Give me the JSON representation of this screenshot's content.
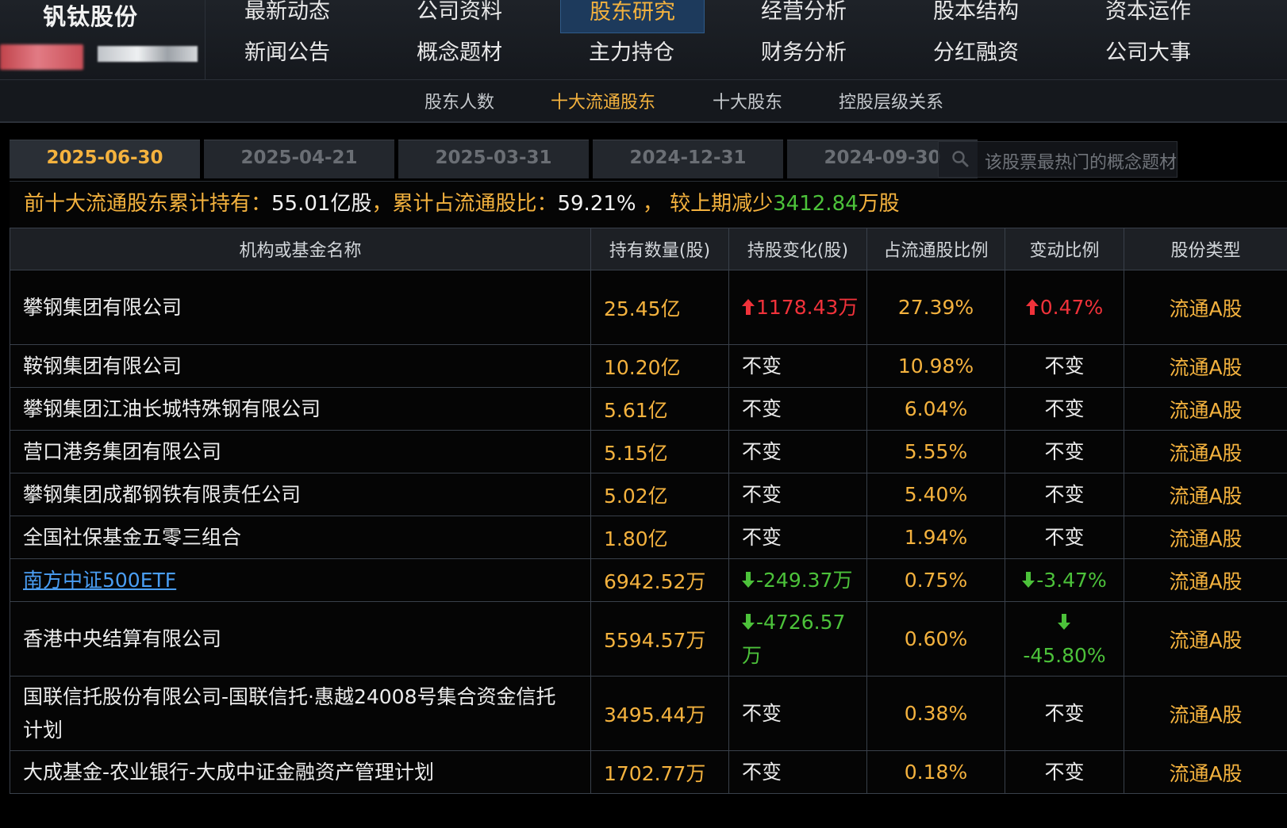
{
  "header": {
    "stock_name": "钒钛股份",
    "nav_row1": [
      "最新动态",
      "公司资料",
      "股东研究",
      "经营分析",
      "股本结构",
      "资本运作"
    ],
    "nav_row2": [
      "新闻公告",
      "概念题材",
      "主力持仓",
      "财务分析",
      "分红融资",
      "公司大事"
    ],
    "active_nav": "股东研究"
  },
  "subnav": {
    "items": [
      "股东人数",
      "十大流通股东",
      "十大股东",
      "控股层级关系"
    ],
    "active": "十大流通股东"
  },
  "date_tabs": {
    "items": [
      "2025-06-30",
      "2025-04-21",
      "2025-03-31",
      "2024-12-31",
      "2024-09-30"
    ],
    "active": "2025-06-30"
  },
  "search": {
    "placeholder": "该股票最热门的概念题材",
    "icon": "search-icon"
  },
  "summary": {
    "label_total": "前十大流通股东累计持有：",
    "total_value": "55.01亿股",
    "label_ratio": "，累计占流通股比：",
    "ratio_value": "59.21% ",
    "label_change": "， 较上期减少",
    "change_value": "3412.84",
    "change_unit": "万股"
  },
  "table": {
    "headers": [
      "机构或基金名称",
      "持有数量(股)",
      "持股变化(股)",
      "占流通股比例",
      "变动比例",
      "股份类型"
    ],
    "rows": [
      {
        "name": "攀钢集团有限公司",
        "shares": "25.45亿",
        "change": "1178.43万",
        "change_dir": "up",
        "pct": "27.39%",
        "ratio": "0.47%",
        "ratio_dir": "up",
        "type": "流通A股",
        "link": false
      },
      {
        "name": "鞍钢集团有限公司",
        "shares": "10.20亿",
        "change": "不变",
        "change_dir": "none",
        "pct": "10.98%",
        "ratio": "不变",
        "ratio_dir": "none",
        "type": "流通A股",
        "link": false
      },
      {
        "name": "攀钢集团江油长城特殊钢有限公司",
        "shares": "5.61亿",
        "change": "不变",
        "change_dir": "none",
        "pct": "6.04%",
        "ratio": "不变",
        "ratio_dir": "none",
        "type": "流通A股",
        "link": false
      },
      {
        "name": "营口港务集团有限公司",
        "shares": "5.15亿",
        "change": "不变",
        "change_dir": "none",
        "pct": "5.55%",
        "ratio": "不变",
        "ratio_dir": "none",
        "type": "流通A股",
        "link": false
      },
      {
        "name": "攀钢集团成都钢铁有限责任公司",
        "shares": "5.02亿",
        "change": "不变",
        "change_dir": "none",
        "pct": "5.40%",
        "ratio": "不变",
        "ratio_dir": "none",
        "type": "流通A股",
        "link": false
      },
      {
        "name": "全国社保基金五零三组合",
        "shares": "1.80亿",
        "change": "不变",
        "change_dir": "none",
        "pct": "1.94%",
        "ratio": "不变",
        "ratio_dir": "none",
        "type": "流通A股",
        "link": false
      },
      {
        "name": "南方中证500ETF",
        "shares": "6942.52万",
        "change": "-249.37万",
        "change_dir": "down",
        "pct": "0.75%",
        "ratio": "-3.47%",
        "ratio_dir": "down",
        "type": "流通A股",
        "link": true
      },
      {
        "name": "香港中央结算有限公司",
        "shares": "5594.57万",
        "change": "-4726.57万",
        "change_dir": "down",
        "pct": "0.60%",
        "ratio": "-45.80%",
        "ratio_dir": "down",
        "type": "流通A股",
        "link": false
      },
      {
        "name": "国联信托股份有限公司-国联信托·惠越24008号集合资金信托计划",
        "shares": "3495.44万",
        "change": "不变",
        "change_dir": "none",
        "pct": "0.38%",
        "ratio": "不变",
        "ratio_dir": "none",
        "type": "流通A股",
        "link": false
      },
      {
        "name": "大成基金-农业银行-大成中证金融资产管理计划",
        "shares": "1702.77万",
        "change": "不变",
        "change_dir": "none",
        "pct": "0.18%",
        "ratio": "不变",
        "ratio_dir": "none",
        "type": "流通A股",
        "link": false
      }
    ]
  },
  "colors": {
    "accent": "#f4b23e",
    "up": "#f0323a",
    "down": "#4cc23a",
    "link": "#4a9ef4",
    "active_tab_bg": "#1d3a5c"
  }
}
